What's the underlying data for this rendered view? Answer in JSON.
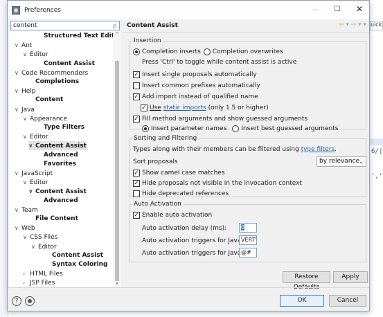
{
  "background": {
    "quick_access": "uick",
    "code_line1": "6/j",
    "code_line2": "','"
  },
  "window": {
    "title": "Preferences",
    "minimize": "—",
    "maximize": "☐",
    "close": "✕"
  },
  "filter": {
    "value": "content",
    "clear": "⊘"
  },
  "tree": [
    {
      "label": "Structured Text Editors",
      "arrow": "",
      "bold": true
    },
    {
      "label": "Ant",
      "arrow": "∨",
      "bold": false
    },
    {
      "label": "Editor",
      "arrow": "∨",
      "bold": false
    },
    {
      "label": "Content Assist",
      "arrow": "",
      "bold": true
    },
    {
      "label": "Code Recommenders",
      "arrow": "∨",
      "bold": false
    },
    {
      "label": "Completions",
      "arrow": "",
      "bold": true
    },
    {
      "label": "Help",
      "arrow": "∨",
      "bold": false
    },
    {
      "label": "Content",
      "arrow": "",
      "bold": true
    },
    {
      "label": "Java",
      "arrow": "∨",
      "bold": false
    },
    {
      "label": "Appearance",
      "arrow": "∨",
      "bold": false
    },
    {
      "label": "Type Filters",
      "arrow": "",
      "bold": true
    },
    {
      "label": "Editor",
      "arrow": "∨",
      "bold": false
    },
    {
      "label": "Content Assist",
      "arrow": "∨",
      "bold": true,
      "selected": true
    },
    {
      "label": "Advanced",
      "arrow": "",
      "bold": true
    },
    {
      "label": "Favorites",
      "arrow": "",
      "bold": true
    },
    {
      "label": "JavaScript",
      "arrow": "∨",
      "bold": false
    },
    {
      "label": "Editor",
      "arrow": "∨",
      "bold": false
    },
    {
      "label": "Content Assist",
      "arrow": "∨",
      "bold": true
    },
    {
      "label": "Advanced",
      "arrow": "",
      "bold": true
    },
    {
      "label": "Team",
      "arrow": "∨",
      "bold": false
    },
    {
      "label": "File Content",
      "arrow": "",
      "bold": true
    },
    {
      "label": "Web",
      "arrow": "∨",
      "bold": false
    },
    {
      "label": "CSS Files",
      "arrow": "∨",
      "bold": false
    },
    {
      "label": "Editor",
      "arrow": "∨",
      "bold": false
    },
    {
      "label": "Content Assist",
      "arrow": "",
      "bold": true
    },
    {
      "label": "Syntax Coloring",
      "arrow": "",
      "bold": true
    },
    {
      "label": "HTML Files",
      "arrow": "›",
      "bold": false
    },
    {
      "label": "JSP Files",
      "arrow": "›",
      "bold": false
    }
  ],
  "scroll": {
    "up": "^",
    "down": "v"
  },
  "page": {
    "title": "Content Assist",
    "nav_back": "⇦",
    "nav_rest": " ▾ ⇨ ▾ ▾"
  },
  "insertion": {
    "title": "Insertion",
    "completion_inserts": "Completion inserts",
    "completion_overwrites": "Completion overwrites",
    "toggle_hint": "Press 'Ctrl' to toggle while content assist is active",
    "insert_single": "Insert single proposals automatically",
    "insert_common": "Insert common prefixes automatically",
    "add_import": "Add import instead of qualified name",
    "use_label": "Use",
    "static_imports": "static imports",
    "static_suffix": "(only 1.5 or higher)",
    "fill_args": "Fill method arguments and show guessed arguments",
    "insert_param_names": "Insert parameter names",
    "insert_best_guessed": "Insert best guessed arguments"
  },
  "sorting": {
    "title": "Sorting and Filtering",
    "types_text": "Types along with their members can be filtered using",
    "type_filters_link": "type filters",
    "sort_proposals": "Sort proposals",
    "sort_value": "by relevance",
    "show_camel": "Show camel case matches",
    "hide_not_visible": "Hide proposals not visible in the invocation context",
    "hide_deprecated": "Hide deprecated references"
  },
  "auto": {
    "title": "Auto Activation",
    "enable": "Enable auto activation",
    "delay_label": "Auto activation delay (ms):",
    "delay_value": "0",
    "java_label": "Auto activation triggers for Java:",
    "java_value": "VERTY",
    "javadoc_label": "Auto activation triggers for Javadoc:",
    "javadoc_value": "@#"
  },
  "buttons": {
    "restore": "Restore Defaults",
    "apply": "Apply",
    "ok": "OK",
    "cancel": "Cancel"
  },
  "bottom": {
    "help": "?"
  }
}
